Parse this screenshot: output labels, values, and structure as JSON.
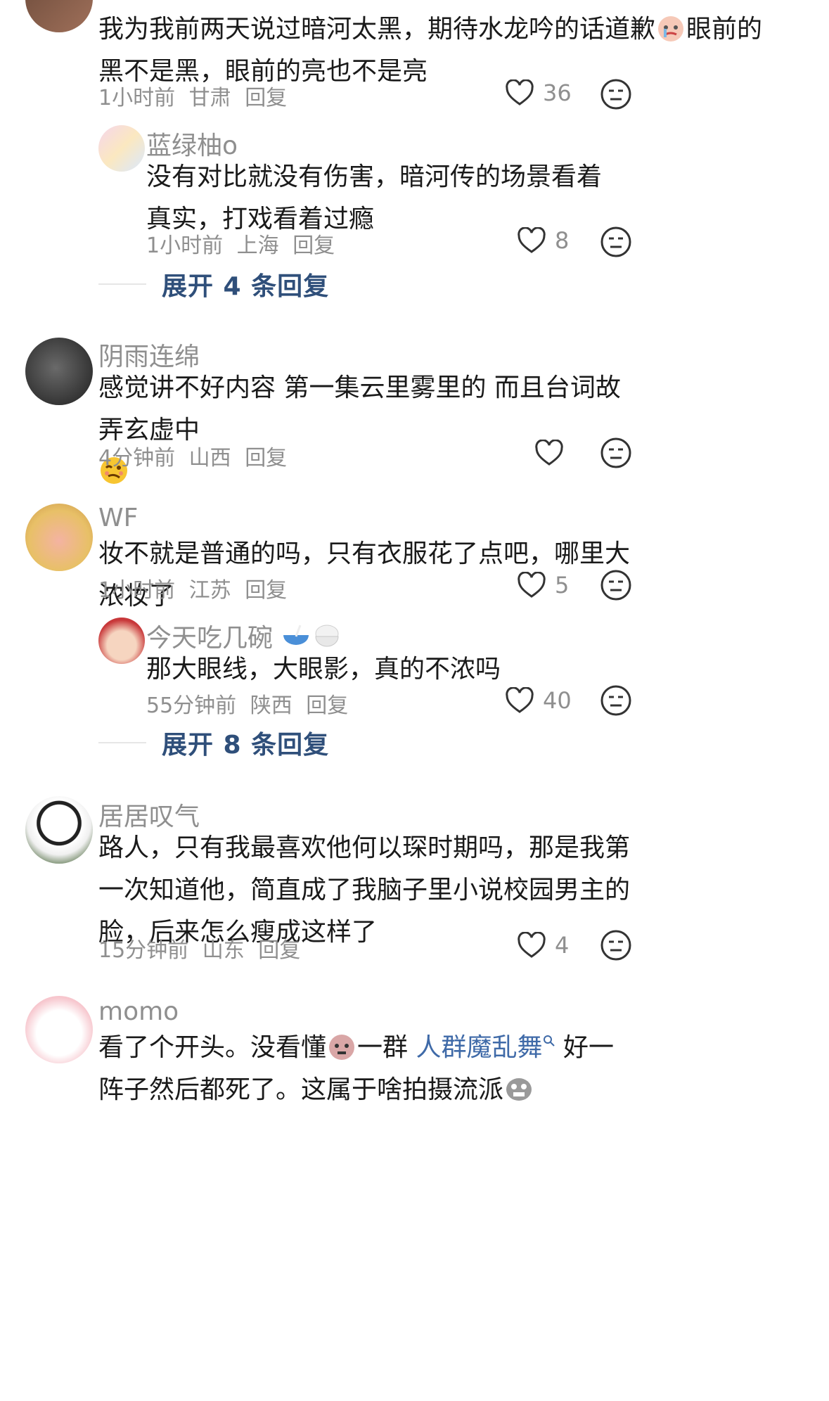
{
  "comments": [
    {
      "username": "",
      "text": "我为我前两天说过暗河太黑，期待水龙吟的话道歉",
      "text_after": "眼前的黑不是黑，眼前的亮也不是亮",
      "time": "1小时前",
      "location": "甘肃",
      "reply": "回复",
      "likes": "36",
      "reply_item": {
        "username": "蓝绿柚o",
        "text": "没有对比就没有伤害，暗河传的场景看着真实，打戏看着过瘾",
        "time": "1小时前",
        "location": "上海",
        "reply": "回复",
        "likes": "8"
      },
      "expand": "展开 4 条回复"
    },
    {
      "username": "阴雨连绵",
      "text": "感觉讲不好内容 第一集云里雾里的 而且台词故弄玄虚中",
      "time": "4分钟前",
      "location": "山西",
      "reply": "回复",
      "likes": ""
    },
    {
      "username": "WF",
      "text": "妆不就是普通的吗，只有衣服花了点吧，哪里大浓妆了",
      "time": "1小时前",
      "location": "江苏",
      "reply": "回复",
      "likes": "5",
      "reply_item": {
        "username": "今天吃几碗",
        "text": "那大眼线，大眼影，真的不浓吗",
        "time": "55分钟前",
        "location": "陕西",
        "reply": "回复",
        "likes": "40"
      },
      "expand": "展开 8 条回复"
    },
    {
      "username": "居居叹气",
      "text": "路人，只有我最喜欢他何以琛时期吗，那是我第一次知道他，简直成了我脑子里小说校园男主的脸，后来怎么瘦成这样了",
      "time": "15分钟前",
      "location": "山东",
      "reply": "回复",
      "likes": "4"
    },
    {
      "username": "momo",
      "text_before": "看了个开头。没看懂",
      "text_mid": "一群",
      "link": "人群魔乱舞",
      "text_after": "好一阵子然后都死了。这属于啥拍摄流派"
    }
  ],
  "colors": {
    "meta": "#8f8f8f",
    "text": "#1a1a1a",
    "expand": "#2f4f7a",
    "link": "#3f6aa8"
  },
  "icons": [
    "heart-icon",
    "dislike-face-icon",
    "search-icon"
  ]
}
